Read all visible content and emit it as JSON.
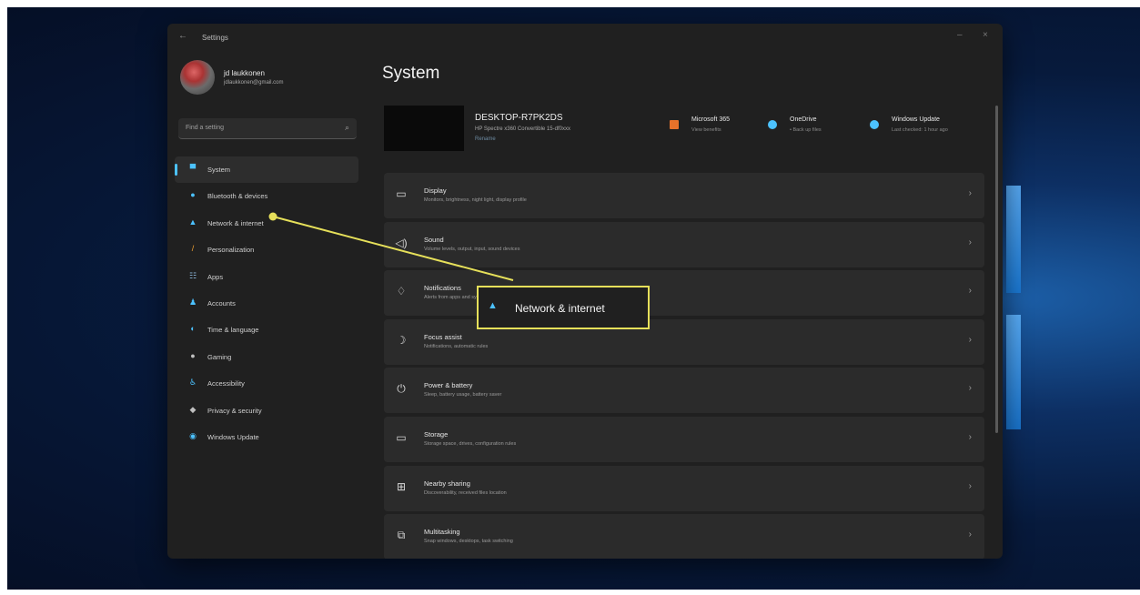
{
  "window": {
    "title": "Settings",
    "back": "←",
    "minimize": "–",
    "close": "×"
  },
  "profile": {
    "name": "jd laukkonen",
    "email": "jdlaukkonen@gmail.com"
  },
  "search": {
    "placeholder": "Find a setting",
    "icon": "⌕"
  },
  "nav": {
    "items": [
      {
        "label": "System",
        "icon": "▀",
        "color": "#4cc2ff"
      },
      {
        "label": "Bluetooth & devices",
        "icon": "●",
        "color": "#4cc2ff"
      },
      {
        "label": "Network & internet",
        "icon": "▲",
        "color": "#4cc2ff"
      },
      {
        "label": "Personalization",
        "icon": "/",
        "color": "#f0a030"
      },
      {
        "label": "Apps",
        "icon": "☷",
        "color": "#8ab4d8"
      },
      {
        "label": "Accounts",
        "icon": "♟",
        "color": "#4cc2ff"
      },
      {
        "label": "Time & language",
        "icon": "◐",
        "color": "#4cc2ff"
      },
      {
        "label": "Gaming",
        "icon": "●",
        "color": "#c0c0c0"
      },
      {
        "label": "Accessibility",
        "icon": "♿",
        "color": "#4cc2ff"
      },
      {
        "label": "Privacy & security",
        "icon": "◆",
        "color": "#c0c0c0"
      },
      {
        "label": "Windows Update",
        "icon": "◉",
        "color": "#4cc2ff"
      }
    ]
  },
  "main": {
    "title": "System",
    "device": {
      "name": "DESKTOP-R7PK2DS",
      "model": "HP Spectre x360 Convertible 15-df0xxx",
      "rename": "Rename"
    },
    "services": [
      {
        "title": "Microsoft 365",
        "sub": "View benefits",
        "icon": "ms365-icon",
        "color": "#e8722a"
      },
      {
        "title": "OneDrive",
        "sub": "• Back up files",
        "icon": "onedrive-icon",
        "color": "#4cc2ff"
      },
      {
        "title": "Windows Update",
        "sub": "Last checked: 1 hour ago",
        "icon": "windows-update-icon",
        "color": "#4cc2ff"
      }
    ],
    "cards": [
      {
        "title": "Display",
        "sub": "Monitors, brightness, night light, display profile",
        "icon": "▭",
        "icon_name": "display-icon"
      },
      {
        "title": "Sound",
        "sub": "Volume levels, output, input, sound devices",
        "icon": "◁)",
        "icon_name": "sound-icon"
      },
      {
        "title": "Notifications",
        "sub": "Alerts from apps and system",
        "icon": "♢",
        "icon_name": "notifications-icon"
      },
      {
        "title": "Focus assist",
        "sub": "Notifications, automatic rules",
        "icon": "☽",
        "icon_name": "focus-assist-icon"
      },
      {
        "title": "Power & battery",
        "sub": "Sleep, battery usage, battery saver",
        "icon": "⏻",
        "icon_name": "power-icon"
      },
      {
        "title": "Storage",
        "sub": "Storage space, drives, configuration rules",
        "icon": "▭",
        "icon_name": "storage-icon"
      },
      {
        "title": "Nearby sharing",
        "sub": "Discoverability, received files location",
        "icon": "⊞",
        "icon_name": "nearby-sharing-icon"
      },
      {
        "title": "Multitasking",
        "sub": "Snap windows, desktops, task switching",
        "icon": "⧉",
        "icon_name": "multitasking-icon"
      }
    ],
    "chevron": "›"
  },
  "callout": {
    "label": "Network & internet",
    "icon": "▲",
    "border_color": "#e6e05a"
  }
}
